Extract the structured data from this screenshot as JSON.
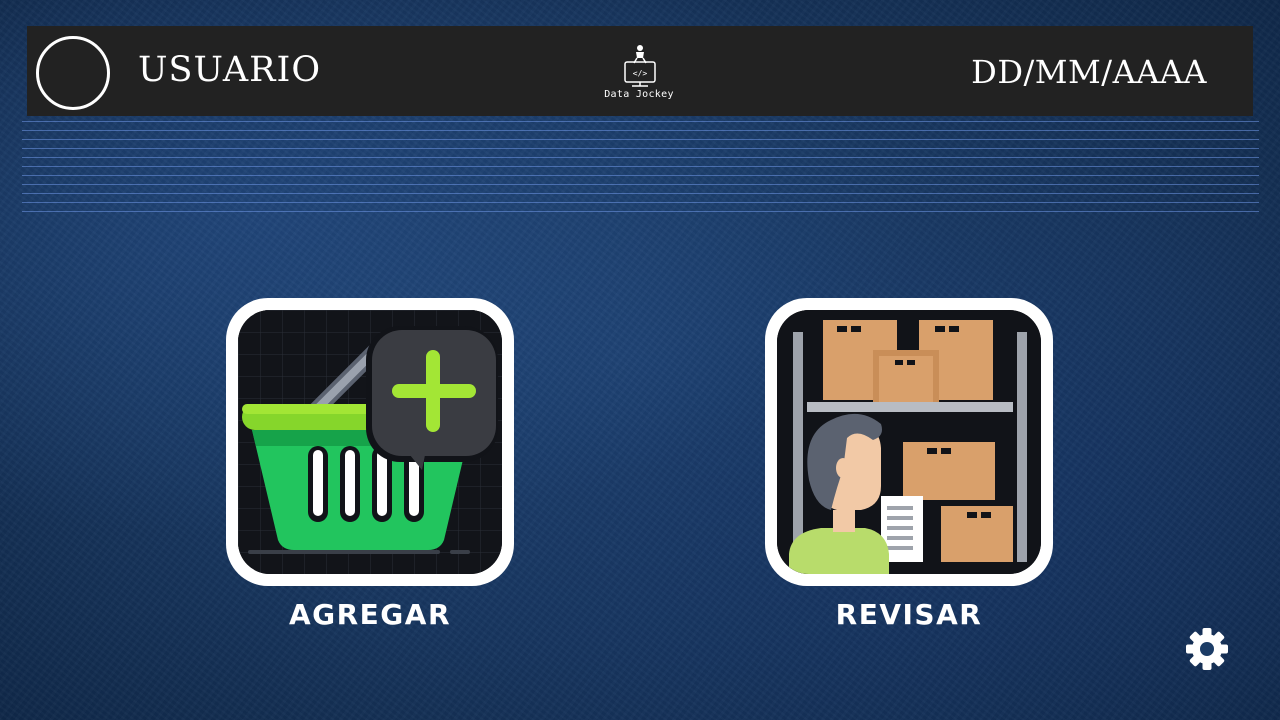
{
  "header": {
    "username": "USUARIO",
    "date": "DD/MM/AAAA",
    "logo_text": "Data Jockey"
  },
  "actions": [
    {
      "label": "AGREGAR",
      "icon": "basket-plus-icon"
    },
    {
      "label": "REVISAR",
      "icon": "warehouse-worker-icon"
    }
  ],
  "settings_icon": "gear-icon",
  "colors": {
    "header_bg": "#222222",
    "background": "#1f4372",
    "basket_green": "#22c55e",
    "plus_lime": "#a3e635",
    "box_tan": "#d9a06b"
  }
}
